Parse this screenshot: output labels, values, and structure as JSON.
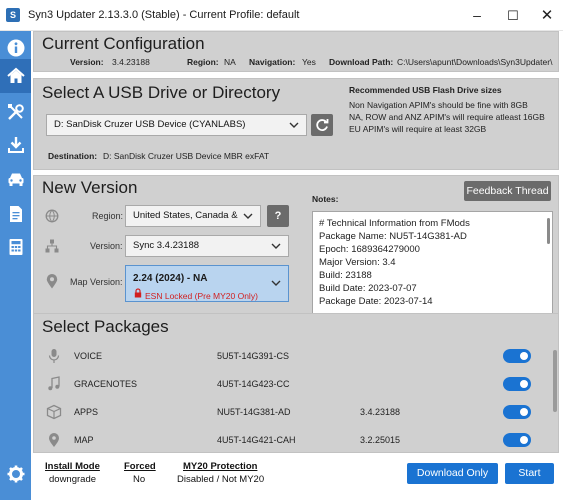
{
  "window": {
    "title": "Syn3 Updater 2.13.3.0 (Stable) - Current Profile: default",
    "icon_letter": "S"
  },
  "sidebar": {
    "items": [
      {
        "icon": "info-icon"
      },
      {
        "icon": "home-icon",
        "active": true
      },
      {
        "icon": "tools-icon"
      },
      {
        "icon": "download-icon"
      },
      {
        "icon": "car-icon"
      },
      {
        "icon": "document-icon"
      },
      {
        "icon": "calculator-icon"
      },
      {
        "icon": "gear-icon"
      }
    ]
  },
  "current_config": {
    "heading": "Current Configuration",
    "version_label": "Version:",
    "version_value": "3.4.23188",
    "region_label": "Region:",
    "region_value": "NA",
    "navigation_label": "Navigation:",
    "navigation_value": "Yes",
    "download_path_label": "Download Path:",
    "download_path_value": "C:\\Users\\apunt\\Downloads\\Syn3Updater\\"
  },
  "usb": {
    "heading": "Select A USB Drive or Directory",
    "drive_value": "D: SanDisk Cruzer USB Device (CYANLABS)",
    "destination_label": "Destination:",
    "destination_value": "D: SanDisk Cruzer USB Device  MBR exFAT",
    "recommend_title": "Recommended USB Flash Drive sizes",
    "recommend_lines": [
      "Non Navigation APIM's should be fine with 8GB",
      "NA, ROW and ANZ APIM's will require atleast 16GB",
      "EU APIM's will require at least 32GB"
    ]
  },
  "new_version": {
    "heading": "New Version",
    "feedback_label": "Feedback Thread",
    "region_label": "Region:",
    "region_value": "United States, Canada &",
    "help_label": "?",
    "version_label": "Version:",
    "version_value": "Sync 3.4.23188",
    "map_label": "Map Version:",
    "map_value": "2.24 (2024) - NA",
    "map_warning": "ESN Locked (Pre MY20 Only)",
    "notes_label": "Notes:",
    "notes_lines": [
      "# Technical Information from FMods",
      "Package Name: NU5T-14G381-AD",
      "Epoch:  1689364279000",
      "Major Version: 3.4",
      "Build: 23188",
      "Build Date:  2023-07-07",
      "Package Date: 2023-07-14"
    ]
  },
  "packages": {
    "heading": "Select Packages",
    "items": [
      {
        "name": "VOICE",
        "part": "5U5T-14G391-CS",
        "version": "",
        "icon": "microphone-icon",
        "enabled": true
      },
      {
        "name": "GRACENOTES",
        "part": "4U5T-14G423-CC",
        "version": "",
        "icon": "music-note-icon",
        "enabled": true
      },
      {
        "name": "APPS",
        "part": "NU5T-14G381-AD",
        "version": "3.4.23188",
        "icon": "box-icon",
        "enabled": true
      },
      {
        "name": "MAP",
        "part": "4U5T-14G421-CAH",
        "version": "3.2.25015",
        "icon": "map-pin-icon",
        "enabled": true
      }
    ]
  },
  "footer": {
    "install_mode_label": "Install Mode",
    "install_mode_value": "downgrade",
    "forced_label": "Forced",
    "forced_value": "No",
    "my20_label": "MY20 Protection",
    "my20_value": "Disabled / Not MY20",
    "download_only_label": "Download Only",
    "start_label": "Start"
  },
  "colors": {
    "sidebar": "#4a8ed6",
    "sidebar_active": "#2f6fb8",
    "accent": "#1a73d2",
    "panel": "#d0d0d0",
    "warning": "#d11f1f"
  }
}
